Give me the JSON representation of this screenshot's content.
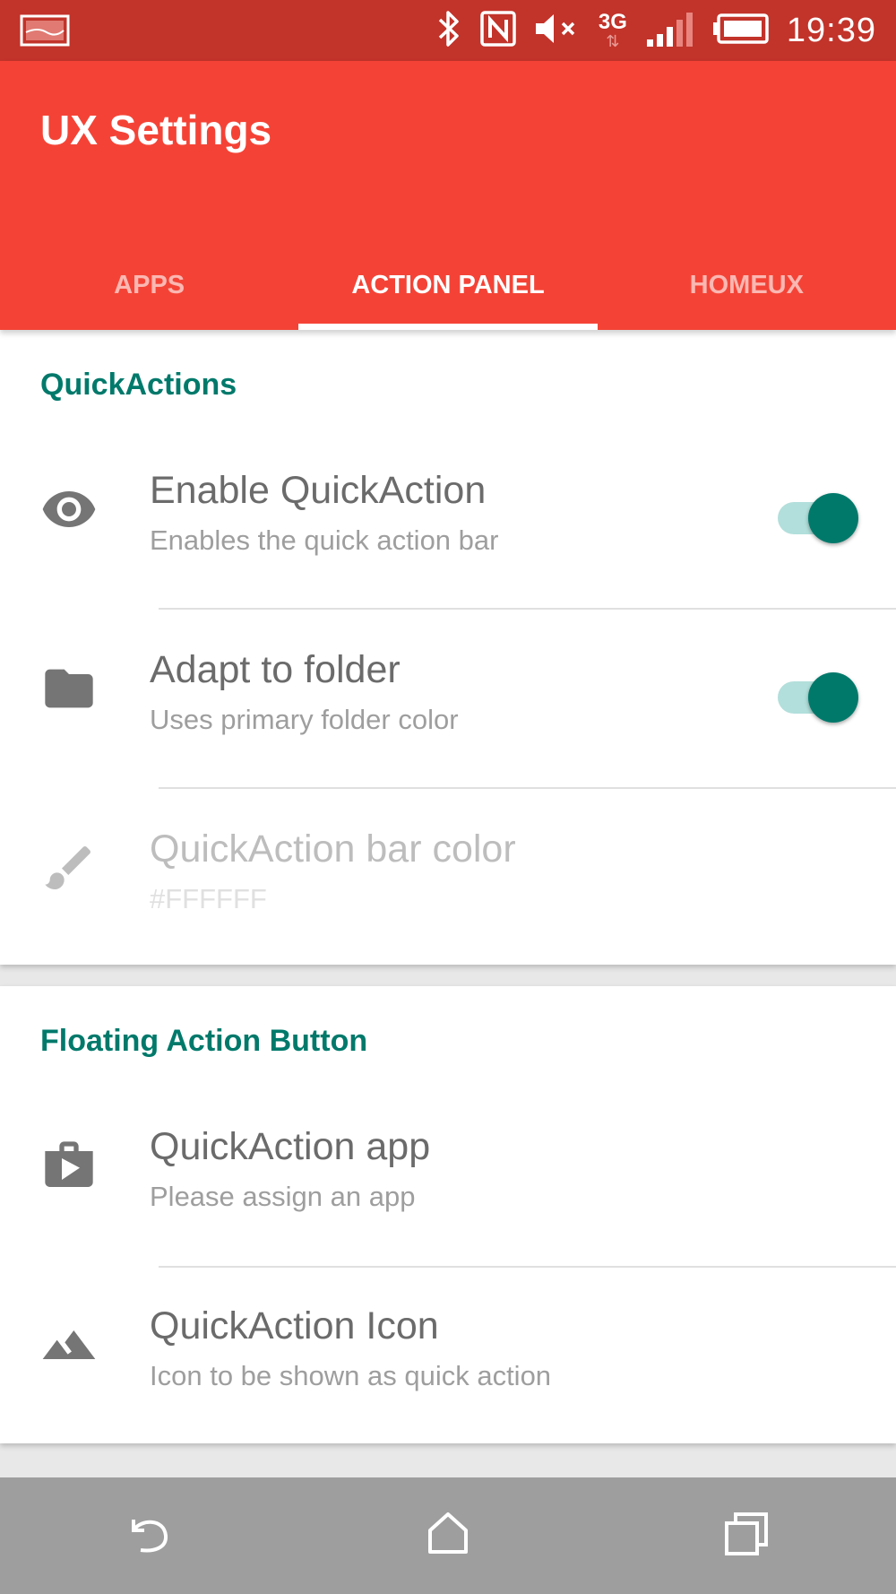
{
  "status_bar": {
    "time": "19:39",
    "network": "3G",
    "icons": [
      "image-notification-icon",
      "bluetooth-icon",
      "nfc-icon",
      "volume-muted-icon",
      "network-3g-icon",
      "signal-icon",
      "battery-icon"
    ]
  },
  "app_bar": {
    "title": "UX Settings",
    "tabs": [
      {
        "label": "APPS",
        "active": false
      },
      {
        "label": "ACTION PANEL",
        "active": true
      },
      {
        "label": "HOMEUX",
        "active": false
      }
    ]
  },
  "sections": [
    {
      "header": "QuickActions",
      "items": [
        {
          "title": "Enable QuickAction",
          "subtitle": "Enables the quick action bar",
          "icon": "eye-icon",
          "toggle": true
        },
        {
          "title": "Adapt to folder",
          "subtitle": "Uses primary folder color",
          "icon": "folder-icon",
          "toggle": true
        },
        {
          "title": "QuickAction bar color",
          "subtitle": "#FFFFFF",
          "icon": "paint-brush-icon",
          "disabled": true
        }
      ]
    },
    {
      "header": "Floating Action Button",
      "items": [
        {
          "title": "QuickAction app",
          "subtitle": "Please assign an app",
          "icon": "shop-bag-icon"
        },
        {
          "title": "QuickAction Icon",
          "subtitle": "Icon to be shown as quick action",
          "icon": "landscape-icon"
        }
      ]
    }
  ],
  "nav_bar": {
    "buttons": [
      "back-icon",
      "home-icon",
      "recents-icon"
    ]
  },
  "colors": {
    "status_bar": "#c2332a",
    "primary": "#f44336",
    "accent": "#00796b",
    "switch_track": "#b2dfdb",
    "nav_bar": "#9e9e9e"
  }
}
